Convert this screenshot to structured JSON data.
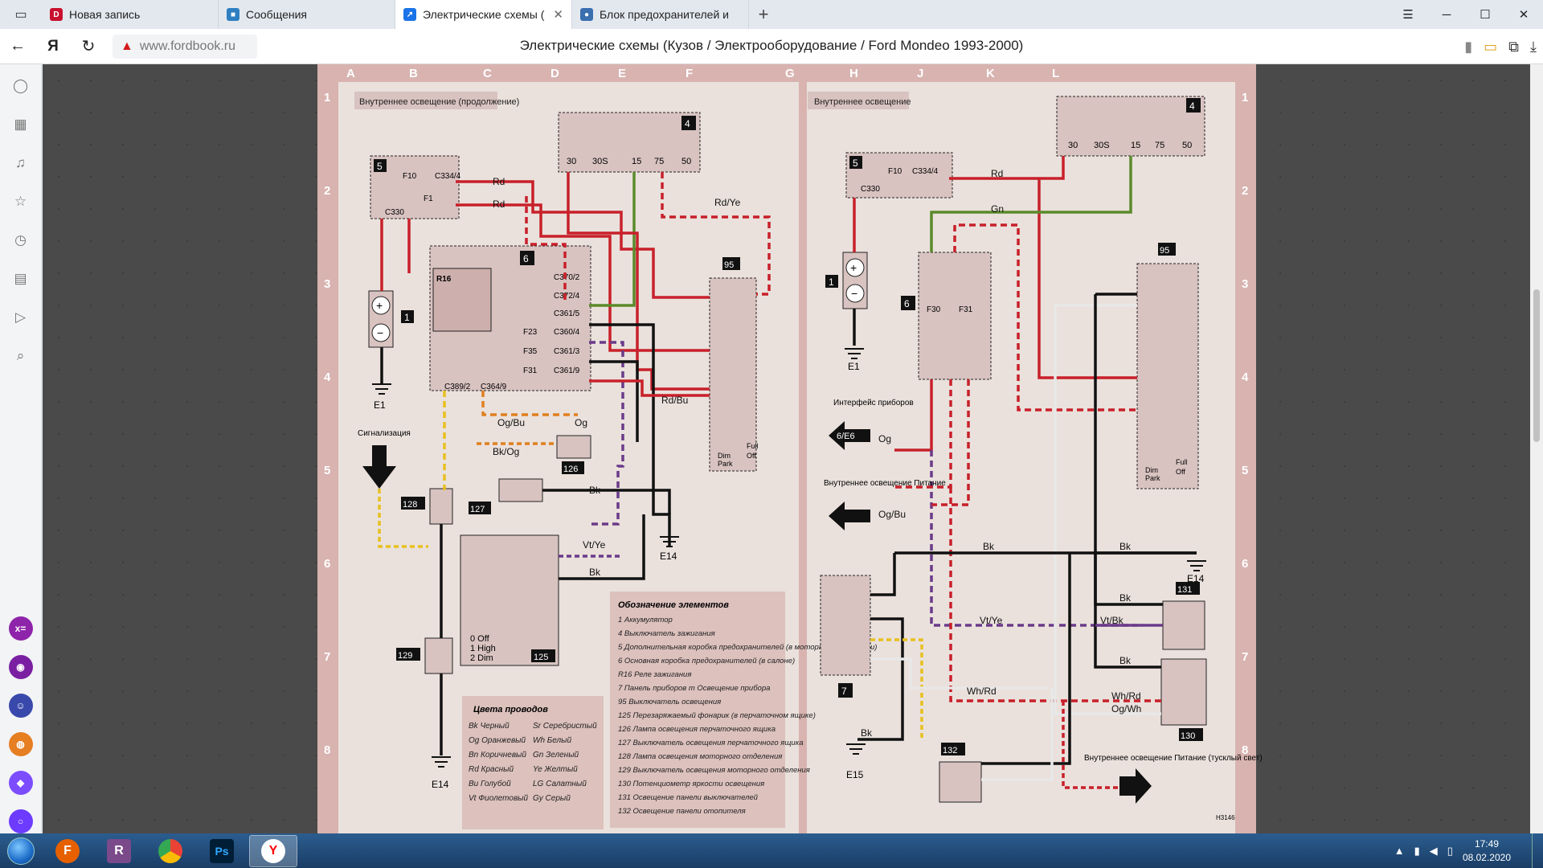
{
  "browser": {
    "tabs": [
      {
        "title": "Новая запись",
        "icon": "d",
        "color": "#c8102e"
      },
      {
        "title": "Сообщения",
        "icon": "s",
        "color": "#2d7fc1"
      },
      {
        "title": "Электрические схемы (",
        "icon": "w",
        "color": "#1a73e8",
        "active": true,
        "close": "✕"
      },
      {
        "title": "Блок предохранителей и",
        "icon": "f",
        "color": "#3a6fb0"
      }
    ],
    "new_tab": "+",
    "url": "www.fordbook.ru",
    "page_title": "Электрические схемы (Кузов / Электрооборудование / Ford Mondeo 1993-2000)"
  },
  "diagram": {
    "col_letters": [
      "A",
      "B",
      "C",
      "D",
      "E",
      "F",
      "G",
      "H",
      "J",
      "K",
      "L"
    ],
    "row_numbers": [
      "1",
      "2",
      "3",
      "4",
      "5",
      "6",
      "7",
      "8"
    ],
    "left_title": "Внутреннее освещение (продолжение)",
    "right_title": "Внутреннее освещение",
    "labels": {
      "alarm": "Сигнализация",
      "instr_iface": "Интерфейс приборов",
      "interior_supply": "Внутреннее освещение Питание",
      "interior_dim": "Внутреннее освещение Питание (тусклый свет)",
      "switch_states": "0 Off\n1 High\n2 Dim"
    },
    "legend_title": "Обозначение элементов",
    "legend": [
      "1 Аккумулятор",
      "4 Выключатель зажигания",
      "5 Дополнительная коробка предохранителей (в моторном отделении)",
      "6 Основная коробка предохранителей (в салоне)",
      "R16 Реле зажигания",
      "7 Панель приборов m Освещение прибора",
      "95 Выключатель освещения",
      "125 Перезаряжаемый фонарик (в перчаточном ящике)",
      "126 Лампа освещения перчаточного ящика",
      "127 Выключатель освещения перчаточного ящика",
      "128 Лампа освещения моторного отделения",
      "129 Выключатель освещения моторного отделения",
      "130 Потенциометр яркости освещения",
      "131 Освещение панели выключателей",
      "132 Освещение панели отопителя"
    ],
    "colors_title": "Цвета проводов",
    "wire_colors": [
      "Bk Черный",
      "Sr Серебристый",
      "Og Оранжевый",
      "Wh Белый",
      "Bn Коричневый",
      "Gn Зеленый",
      "Rd Красный",
      "Ye Желтый",
      "Bu Голубой",
      "LG Салатный",
      "Vt Фиолетовый",
      "Gy Серый"
    ],
    "ground_labels": [
      "E1",
      "E14",
      "E14",
      "E1",
      "E14",
      "E15"
    ]
  },
  "taskbar": {
    "apps": [
      {
        "name": "firefox",
        "color": "#e66000",
        "glyph": "F"
      },
      {
        "name": "winrar",
        "color": "#7a4a8a",
        "glyph": "R"
      },
      {
        "name": "chrome",
        "color": "#34a853",
        "glyph": "C"
      },
      {
        "name": "photoshop",
        "color": "#001e36",
        "glyph": "Ps"
      },
      {
        "name": "yandex",
        "color": "#ff0000",
        "glyph": "Y"
      }
    ],
    "time": "17:49",
    "date": "08.02.2020"
  },
  "colors": {
    "wire_red": "#c8202a",
    "wire_green": "#5b8a2a",
    "wire_violet": "#6a3a8a",
    "wire_black": "#111111",
    "page_bg": "#eae1dc",
    "frame": "#d8b3b0"
  }
}
